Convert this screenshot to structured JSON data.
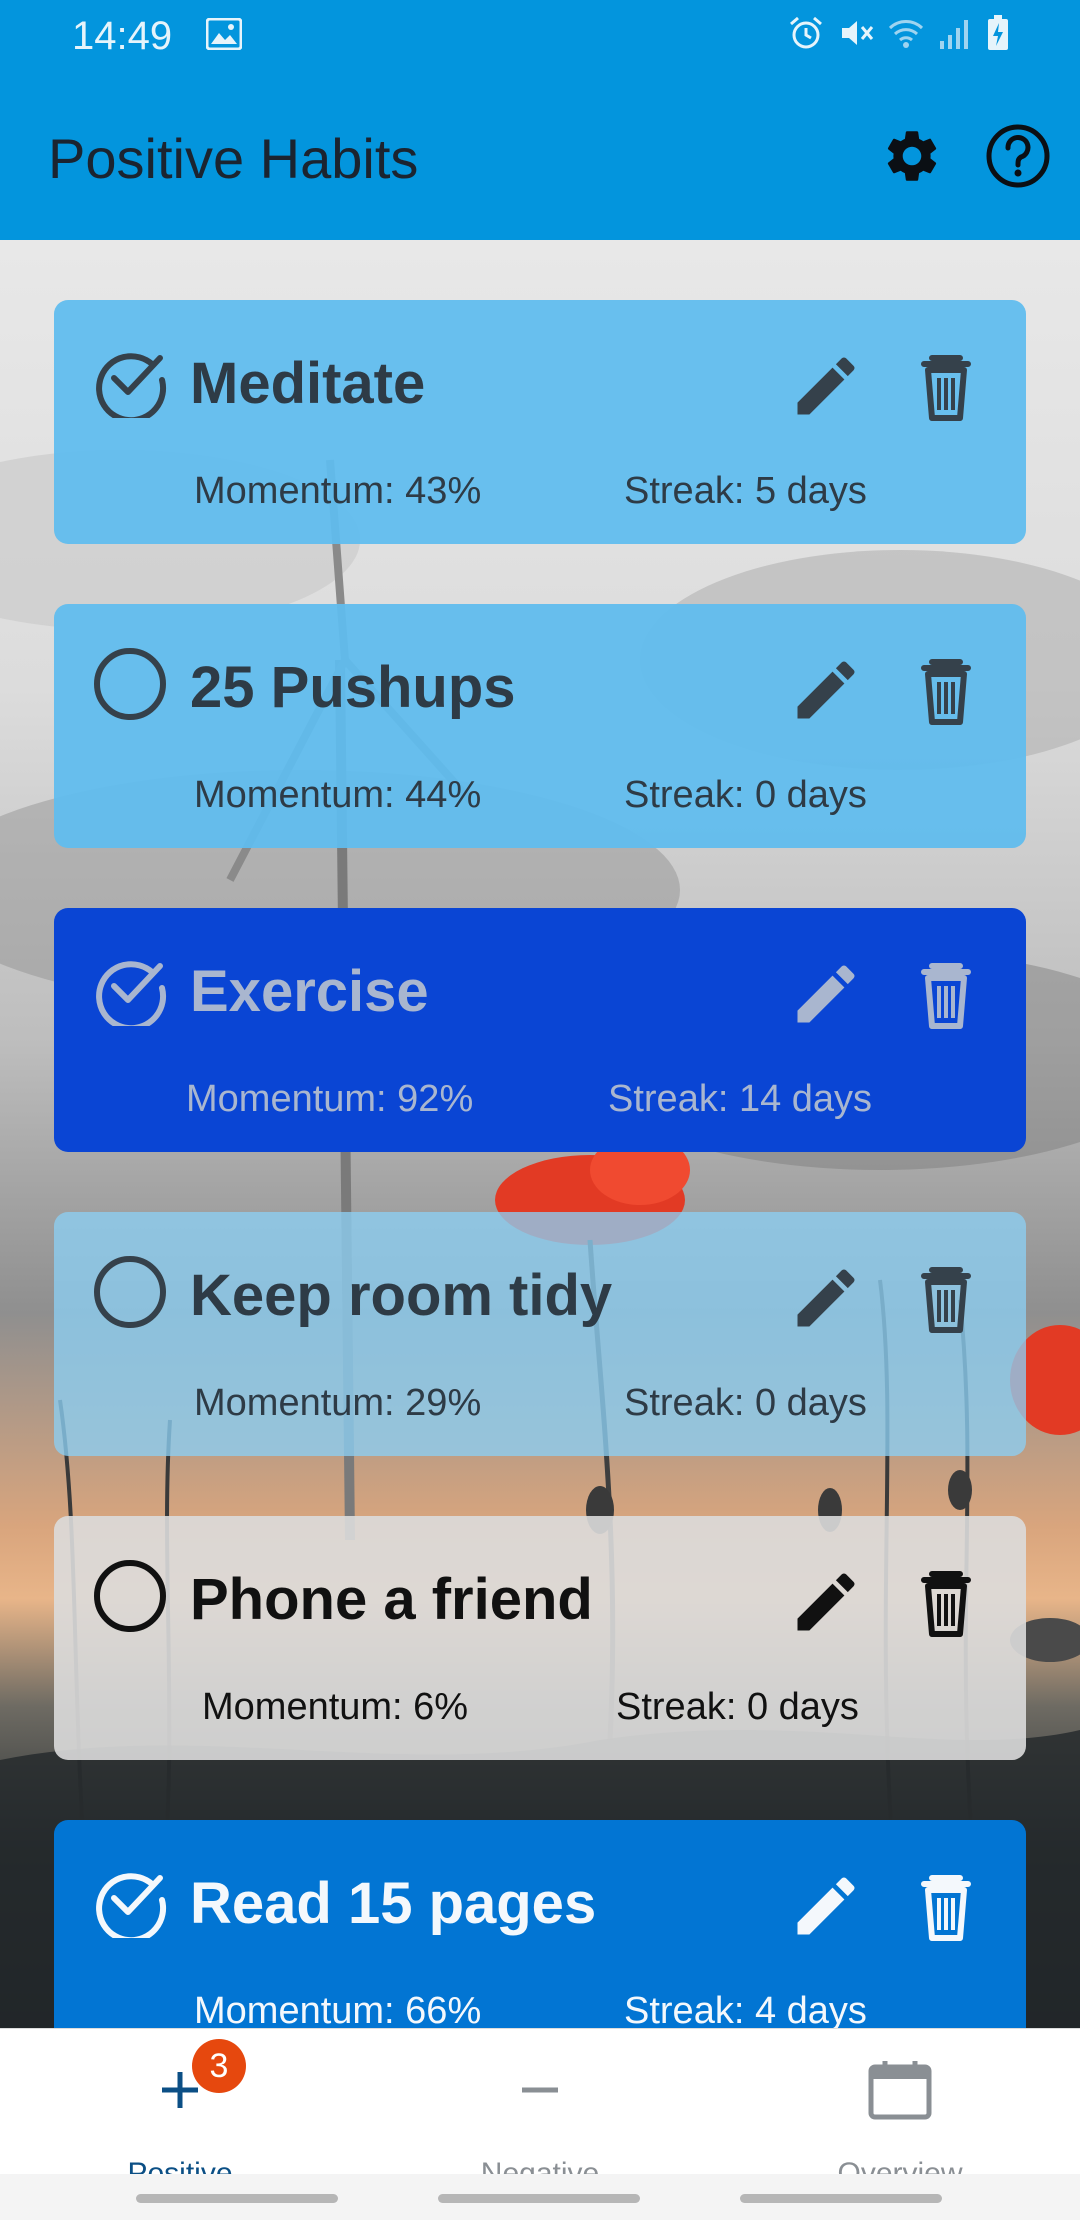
{
  "status_bar": {
    "time": "14:49",
    "icons": [
      "image-icon",
      "alarm-icon",
      "vibrate-mute-icon",
      "wifi-icon",
      "signal-icon",
      "battery-charging-icon"
    ]
  },
  "app_bar": {
    "title": "Positive Habits",
    "actions": [
      "settings-icon",
      "help-icon"
    ],
    "color": "#0395dd"
  },
  "habits": [
    {
      "name": "Meditate",
      "checked": true,
      "momentum": "Momentum: 43%",
      "streak": "Streak: 5 days",
      "color": "#60bcee"
    },
    {
      "name": "25 Pushups",
      "checked": false,
      "momentum": "Momentum: 44%",
      "streak": "Streak: 0 days",
      "color": "#60bcee"
    },
    {
      "name": "Exercise",
      "checked": true,
      "momentum": "Momentum: 92%",
      "streak": "Streak: 14 days",
      "color": "#0a45d4"
    },
    {
      "name": "Keep room tidy",
      "checked": false,
      "momentum": "Momentum: 29%",
      "streak": "Streak: 0 days",
      "color": "#8ccef2"
    },
    {
      "name": "Phone a friend",
      "checked": false,
      "momentum": "Momentum: 6%",
      "streak": "Streak: 0 days",
      "color": "#dcdcdc"
    },
    {
      "name": "Read 15 pages",
      "checked": true,
      "momentum": "Momentum: 66%",
      "streak": "Streak: 4 days",
      "color": "#0275d3"
    }
  ],
  "bottom_nav": {
    "items": [
      {
        "label": "Positive",
        "icon": "plus-icon",
        "badge": "3",
        "active": true
      },
      {
        "label": "Negative",
        "icon": "minus-icon",
        "active": false
      },
      {
        "label": "Overview",
        "icon": "calendar-icon",
        "active": false
      }
    ]
  }
}
